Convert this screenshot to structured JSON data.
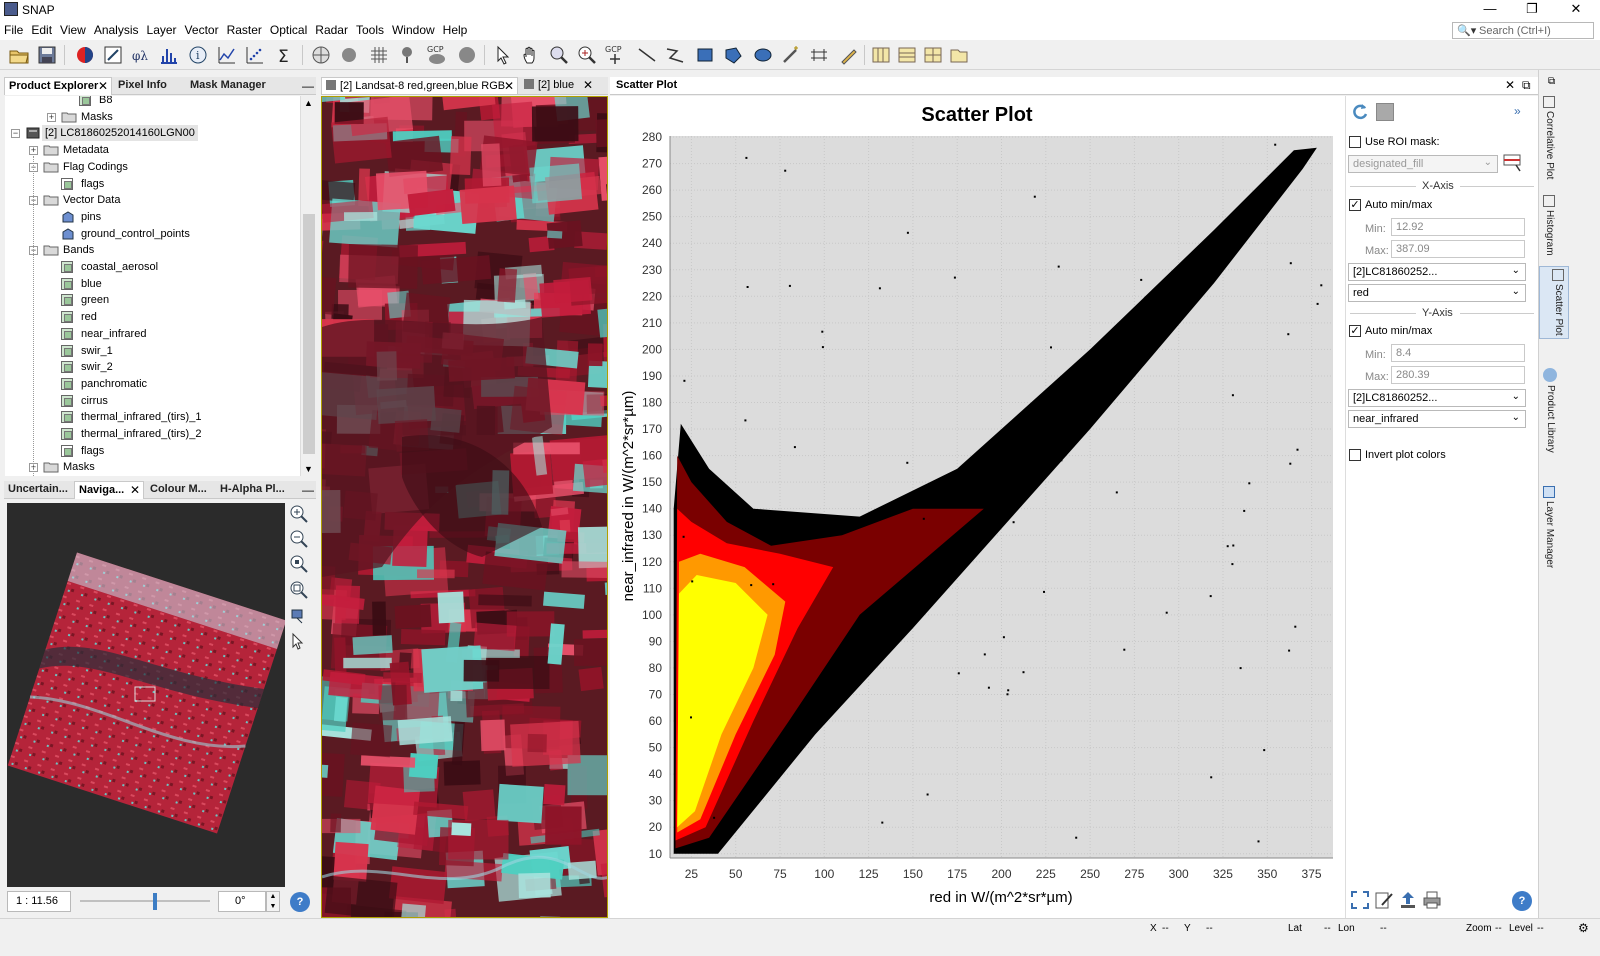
{
  "window": {
    "title": "SNAP",
    "minimize": "—",
    "restore": "❐",
    "close": "✕"
  },
  "menu": [
    "File",
    "Edit",
    "View",
    "Analysis",
    "Layer",
    "Vector",
    "Raster",
    "Optical",
    "Radar",
    "Tools",
    "Window",
    "Help"
  ],
  "search": {
    "placeholder": "Search (Ctrl+I)"
  },
  "toolbar": {
    "gcp_label": "GCP",
    "gcp_tool_label": "GCP"
  },
  "left_top_tabs": [
    {
      "label": "Product Explorer",
      "active": true
    },
    {
      "label": "Pixel Info",
      "active": false
    },
    {
      "label": "Mask Manager",
      "active": false
    }
  ],
  "tree": {
    "rows": [
      {
        "label": "B8",
        "indent": 3,
        "icon": "band"
      },
      {
        "label": "Masks",
        "indent": 2,
        "icon": "folder",
        "expander": "+"
      },
      {
        "label": "[2] LC81860252014160LGN00",
        "indent": 0,
        "icon": "product",
        "expander": "−",
        "selected": true
      },
      {
        "label": "Metadata",
        "indent": 1,
        "icon": "folder",
        "expander": "+"
      },
      {
        "label": "Flag Codings",
        "indent": 1,
        "icon": "folder",
        "expander": "−"
      },
      {
        "label": "flags",
        "indent": 2,
        "icon": "flag"
      },
      {
        "label": "Vector Data",
        "indent": 1,
        "icon": "folder",
        "expander": "−"
      },
      {
        "label": "pins",
        "indent": 2,
        "icon": "vector"
      },
      {
        "label": "ground_control_points",
        "indent": 2,
        "icon": "vector"
      },
      {
        "label": "Bands",
        "indent": 1,
        "icon": "folder",
        "expander": "−"
      },
      {
        "label": "coastal_aerosol",
        "indent": 2,
        "icon": "band"
      },
      {
        "label": "blue",
        "indent": 2,
        "icon": "band"
      },
      {
        "label": "green",
        "indent": 2,
        "icon": "band"
      },
      {
        "label": "red",
        "indent": 2,
        "icon": "band"
      },
      {
        "label": "near_infrared",
        "indent": 2,
        "icon": "band"
      },
      {
        "label": "swir_1",
        "indent": 2,
        "icon": "band"
      },
      {
        "label": "swir_2",
        "indent": 2,
        "icon": "band"
      },
      {
        "label": "panchromatic",
        "indent": 2,
        "icon": "band"
      },
      {
        "label": "cirrus",
        "indent": 2,
        "icon": "band"
      },
      {
        "label": "thermal_infrared_(tirs)_1",
        "indent": 2,
        "icon": "band"
      },
      {
        "label": "thermal_infrared_(tirs)_2",
        "indent": 2,
        "icon": "band"
      },
      {
        "label": "flags",
        "indent": 2,
        "icon": "flag"
      },
      {
        "label": "Masks",
        "indent": 1,
        "icon": "folder",
        "expander": "+"
      }
    ]
  },
  "left_bottom_tabs": [
    {
      "label": "Uncertain...",
      "active": false
    },
    {
      "label": "Naviga...",
      "active": true
    },
    {
      "label": "Colour M...",
      "active": false
    },
    {
      "label": "H-Alpha Pl...",
      "active": false
    }
  ],
  "navigation": {
    "scale": "1 : 11.56",
    "rotation": "0°",
    "slider_position": 0.58
  },
  "doc_tabs": [
    {
      "label": "[2] Landsat-8 red,green,blue RGB"
    },
    {
      "label": "[2] blue"
    }
  ],
  "scatter_window": {
    "tab_label": "Scatter Plot"
  },
  "chart_data": {
    "type": "scatter",
    "title": "Scatter Plot",
    "xlabel": "red in W/(m^2*sr*µm)",
    "ylabel": "near_infrared in W/(m^2*sr*µm)",
    "xlim": [
      12.92,
      387.09
    ],
    "ylim": [
      8.4,
      280.39
    ],
    "xticks": [
      25,
      50,
      75,
      100,
      125,
      150,
      175,
      200,
      225,
      250,
      275,
      300,
      325,
      350,
      375
    ],
    "yticks": [
      10,
      20,
      30,
      40,
      50,
      60,
      70,
      80,
      90,
      100,
      110,
      120,
      130,
      140,
      150,
      160,
      170,
      180,
      190,
      200,
      210,
      220,
      230,
      240,
      250,
      260,
      270,
      280
    ],
    "grid": true,
    "density_colors": [
      "#000000",
      "#7a0000",
      "#ff0000",
      "#ff9900",
      "#ffff00"
    ],
    "background": "#dcdcdc"
  },
  "controls": {
    "use_roi_mask": {
      "label": "Use ROI mask:",
      "checked": false
    },
    "roi_mask_value": "designated_fill",
    "x_axis": {
      "header": "X-Axis",
      "auto_label": "Auto min/max",
      "auto_checked": true,
      "min_label": "Min:",
      "min_value": "12.92",
      "max_label": "Max:",
      "max_value": "387.09",
      "product": "[2]LC81860252...",
      "band": "red"
    },
    "y_axis": {
      "header": "Y-Axis",
      "auto_label": "Auto min/max",
      "auto_checked": true,
      "min_label": "Min:",
      "min_value": "8.4",
      "max_label": "Max:",
      "max_value": "280.39",
      "product": "[2]LC81860252...",
      "band": "near_infrared"
    },
    "invert_colors": {
      "label": "Invert plot colors",
      "checked": false
    },
    "help": "?"
  },
  "sidebar_tabs": [
    "Correlative Plot",
    "Histogram",
    "Scatter Plot",
    "Product Library",
    "Layer Manager"
  ],
  "statusbar": {
    "x": "X",
    "x_val": "--",
    "y": "Y",
    "y_val": "--",
    "lat": "Lat",
    "lat_val": "--",
    "lon": "Lon",
    "lon_val": "--",
    "zoom": "Zoom",
    "zoom_val": "--",
    "level": "Level",
    "level_val": "--"
  },
  "colors": {
    "accent": "#3c8fd8",
    "window_bg": "#f0f0f0",
    "image_red": "#c41d3c",
    "image_cyan": "#4ecfc1"
  }
}
